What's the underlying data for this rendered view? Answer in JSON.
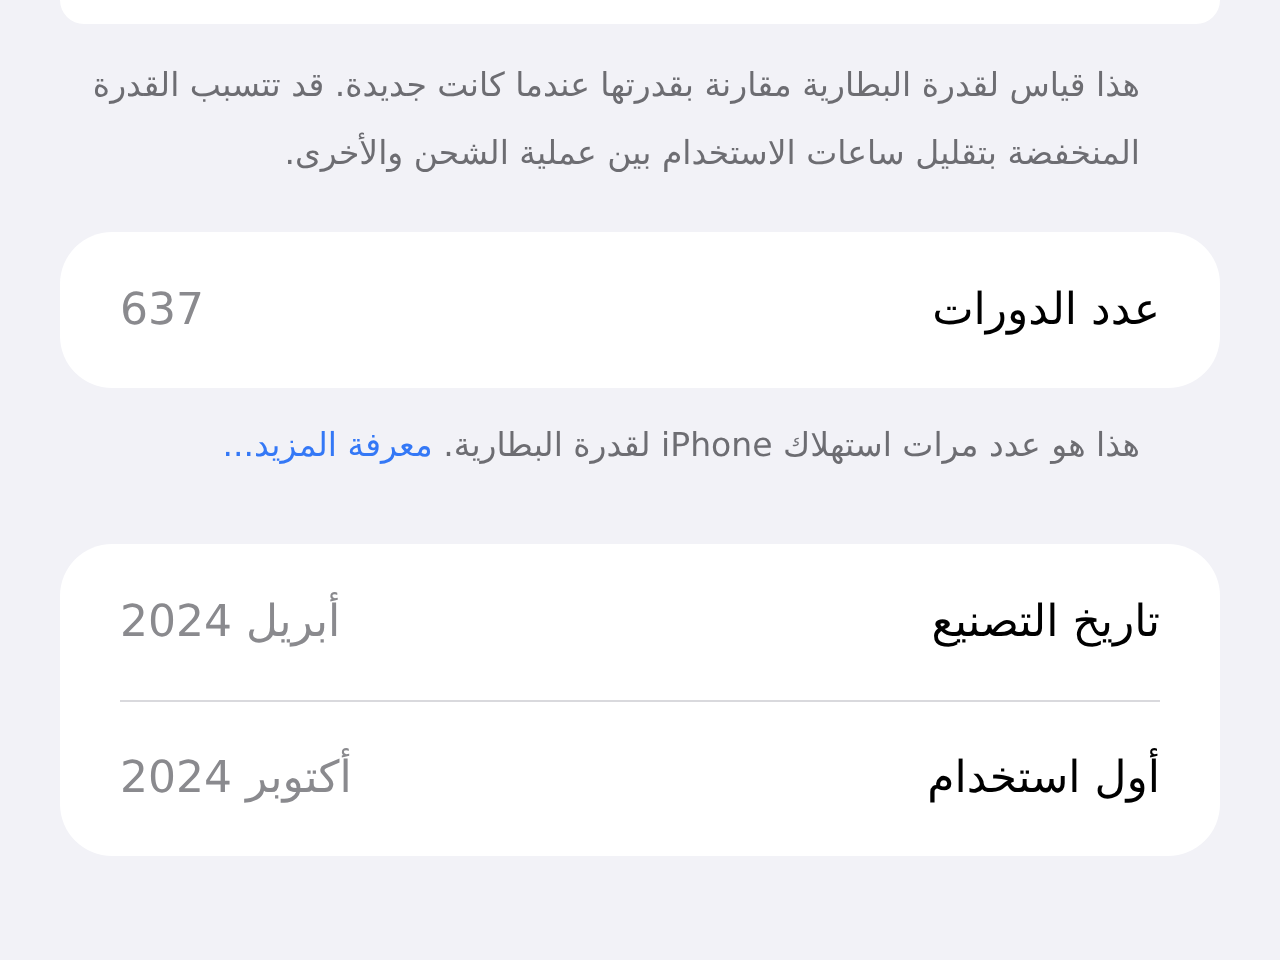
{
  "battery_capacity_note": "هذا قياس لقدرة البطارية مقارنة بقدرتها عندما كانت جديدة. قد تتسبب القدرة المنخفضة بتقليل ساعات الاستخدام بين عملية الشحن والأخرى.",
  "cycle_group": {
    "rows": [
      {
        "label": "عدد الدورات",
        "value": "637"
      }
    ]
  },
  "cycle_note": {
    "text": "هذا هو عدد مرات استهلاك iPhone لقدرة البطارية.",
    "link": "معرفة المزيد..."
  },
  "dates_group": {
    "rows": [
      {
        "label": "تاريخ التصنيع",
        "value": "أبريل 2024"
      },
      {
        "label": "أول استخدام",
        "value": "أكتوبر 2024"
      }
    ]
  }
}
